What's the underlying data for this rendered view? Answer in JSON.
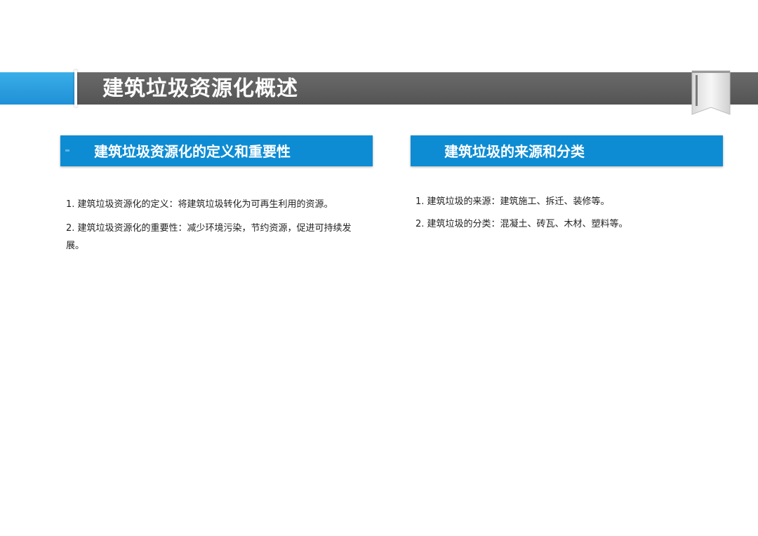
{
  "header": {
    "title": "建筑垃圾资源化概述",
    "accent_color": "#2a9fe0",
    "bar_color": "#5e5e5e"
  },
  "sections": [
    {
      "heading": "建筑垃圾资源化的定义和重要性",
      "color": "#0d8cd4",
      "paragraphs": [
        "1. 建筑垃圾资源化的定义：将建筑垃圾转化为可再生利用的资源。",
        "2. 建筑垃圾资源化的重要性：减少环境污染，节约资源，促进可持续发展。"
      ]
    },
    {
      "heading": "建筑垃圾的来源和分类",
      "color": "#0d8cd4",
      "paragraphs": [
        "1. 建筑垃圾的来源：建筑施工、拆迁、装修等。",
        "2. 建筑垃圾的分类：混凝土、砖瓦、木材、塑料等。"
      ]
    }
  ],
  "icons": {
    "bookmark": "bookmark-icon"
  }
}
